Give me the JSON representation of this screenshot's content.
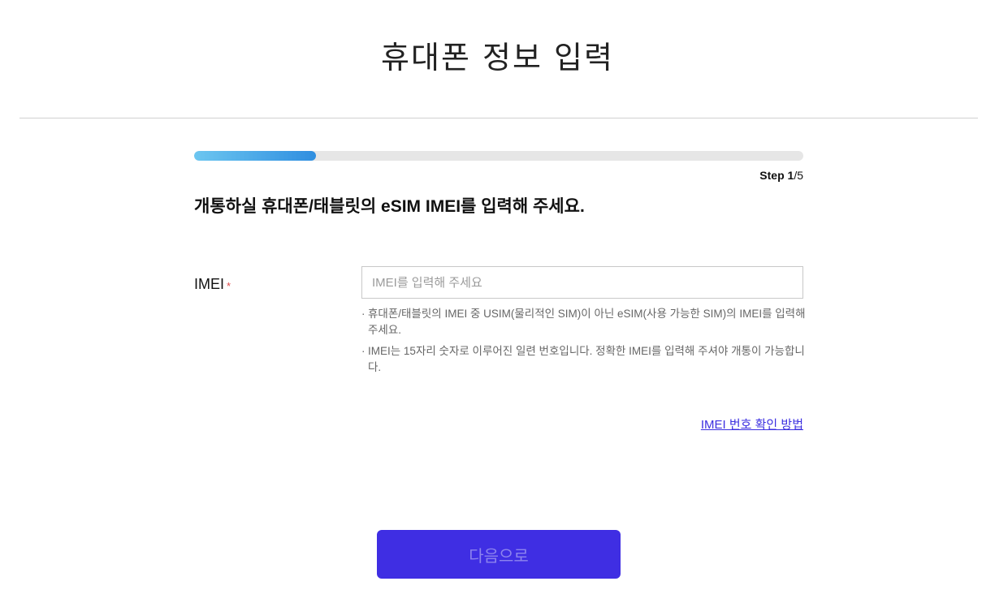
{
  "header": {
    "title": "휴대폰 정보 입력"
  },
  "progress": {
    "step_word": "Step",
    "current": "1",
    "separator_total": "/5",
    "fraction": 0.2,
    "fill_colors": [
      "#6cc6f0",
      "#2f8ee0"
    ],
    "track_color": "#e6e6e6"
  },
  "instruction": "개통하실 휴대폰/태블릿의 eSIM IMEI를 입력해 주세요.",
  "form": {
    "imei_label": "IMEI",
    "required_mark": "*",
    "imei_value": "",
    "imei_placeholder": "IMEI를 입력해 주세요",
    "notes": [
      "휴대폰/태블릿의 IMEI 중 USIM(물리적인 SIM)이 아닌 eSIM(사용 가능한 SIM)의 IMEI를 입력해 주세요.",
      "IMEI는 15자리 숫자로 이루어진 일련 번호입니다. 정확한 IMEI를 입력해 주셔야 개통이 가능합니다."
    ],
    "bullet": "·"
  },
  "help_link": "IMEI 번호 확인 방법",
  "next_button": "다음으로",
  "colors": {
    "accent": "#3f2ee3",
    "link": "#3b2fe0",
    "required": "#e04a4a"
  }
}
